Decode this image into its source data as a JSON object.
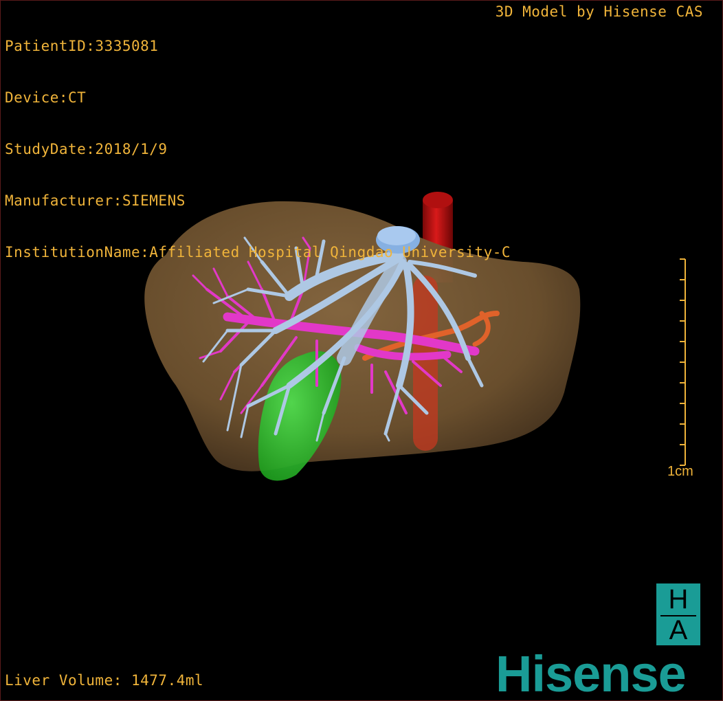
{
  "overlay": {
    "patient_id": "PatientID:3335081",
    "device": "Device:CT",
    "study_date": "StudyDate:2018/1/9",
    "manufacturer": "Manufacturer:SIEMENS",
    "institution": "InstitutionName:Affiliated Hospital Qingdao University-C",
    "vendor": "3D Model by Hisense CAS",
    "liver_volume": "Liver Volume: 1477.4ml",
    "scale_label": "1cm"
  },
  "branding": {
    "ha_top": "H",
    "ha_bottom": "A",
    "wordmark": "Hisense"
  },
  "colors": {
    "overlay_text": "#f0b43a",
    "liver": "#7a5b36",
    "portal_vein": "#aec8e4",
    "hepatic_artery": "#e238c8",
    "ivc": "#c41212",
    "gallbladder": "#2fc12f",
    "brand_teal": "#1a9c96"
  },
  "icons": {
    "ha": "ha-logo-icon",
    "model": "liver-3d-model"
  }
}
